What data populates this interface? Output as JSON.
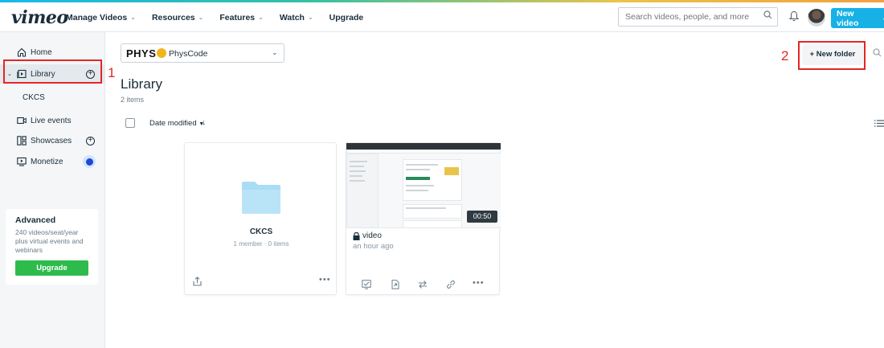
{
  "brand": {
    "logo": "vimeo"
  },
  "nav": {
    "items": [
      {
        "label": "Manage Videos",
        "dropdown": true
      },
      {
        "label": "Resources",
        "dropdown": true
      },
      {
        "label": "Features",
        "dropdown": true
      },
      {
        "label": "Watch",
        "dropdown": true
      },
      {
        "label": "Upgrade",
        "dropdown": false
      }
    ],
    "search_placeholder": "Search videos, people, and more",
    "new_video_label": "New video"
  },
  "sidebar": {
    "items": [
      {
        "label": "Home",
        "icon": "home-icon"
      },
      {
        "label": "Library",
        "icon": "library-icon"
      },
      {
        "label": "CKCS"
      },
      {
        "label": "Live events",
        "icon": "live-events-icon"
      },
      {
        "label": "Showcases",
        "icon": "showcases-icon"
      },
      {
        "label": "Monetize",
        "icon": "monetize-icon"
      }
    ],
    "advanced": {
      "title": "Advanced",
      "description": "240 videos/seat/year plus virtual events and webinars",
      "button": "Upgrade"
    }
  },
  "annotations": {
    "label_1": "1",
    "label_2": "2"
  },
  "main": {
    "folder_select": {
      "brand": "PHYS",
      "name": "PhysCode"
    },
    "title": "Library",
    "count": "2 items",
    "new_folder_label": "+ New folder",
    "sort_label": "Date modified",
    "sort_direction": "↓",
    "cards": [
      {
        "type": "folder",
        "title": "CKCS",
        "meta": "1 member · 0 items"
      },
      {
        "type": "video",
        "title": "video",
        "time": "an hour ago",
        "duration": "00:50"
      }
    ]
  },
  "colors": {
    "accent": "#17b1e6",
    "upgrade": "#2dbb4c",
    "annotation": "#e32626",
    "folder": "#a9dcf5"
  }
}
